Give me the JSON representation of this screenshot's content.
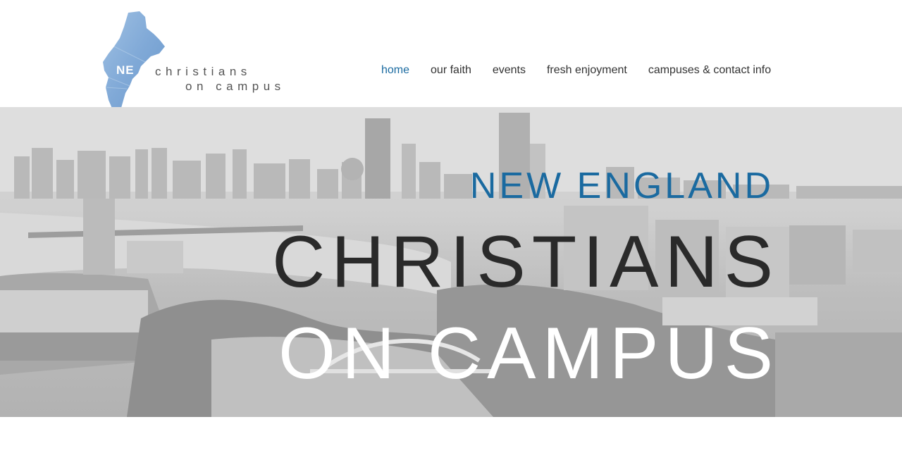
{
  "logo": {
    "abbrev": "NE",
    "line1": "christians",
    "line2": "on campus"
  },
  "nav": {
    "items": [
      {
        "label": "home",
        "active": true
      },
      {
        "label": "our faith",
        "active": false
      },
      {
        "label": "events",
        "active": false
      },
      {
        "label": "fresh enjoyment",
        "active": false
      },
      {
        "label": "campuses & contact info",
        "active": false
      }
    ]
  },
  "hero": {
    "line1": "NEW ENGLAND",
    "line2": "CHRISTIANS",
    "line3": "ON CAMPUS"
  },
  "colors": {
    "accent": "#1a6aa0",
    "dark_text": "#2a2a2a",
    "hero_background": "#c8c8c8"
  }
}
